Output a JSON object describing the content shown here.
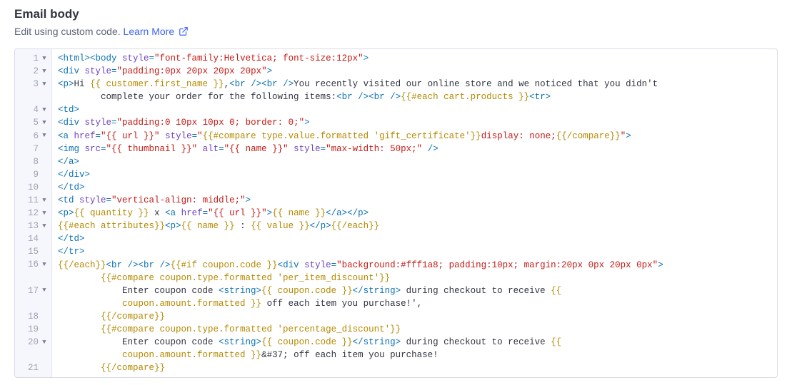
{
  "header": {
    "title": "Email body",
    "subtitle": "Edit using custom code.",
    "learn_more_label": "Learn More"
  },
  "editor": {
    "lines": [
      {
        "n": 1,
        "fold": true,
        "segments": [
          {
            "c": "tag",
            "t": "<html><body"
          },
          {
            "c": "attr",
            "t": " style"
          },
          {
            "c": "tag",
            "t": "="
          },
          {
            "c": "str",
            "t": "\"font-family:Helvetica; font-size:12px\""
          },
          {
            "c": "tag",
            "t": ">"
          }
        ]
      },
      {
        "n": 2,
        "fold": true,
        "segments": [
          {
            "c": "tag",
            "t": "<div"
          },
          {
            "c": "attr",
            "t": " style"
          },
          {
            "c": "tag",
            "t": "="
          },
          {
            "c": "str",
            "t": "\"padding:0px 20px 20px 20px\""
          },
          {
            "c": "tag",
            "t": ">"
          }
        ]
      },
      {
        "n": 3,
        "fold": true,
        "segments": [
          {
            "c": "tag",
            "t": "<p>"
          },
          {
            "c": "txt",
            "t": "Hi "
          },
          {
            "c": "hb",
            "t": "{{ customer.first_name }}"
          },
          {
            "c": "txt",
            "t": ","
          },
          {
            "c": "tag",
            "t": "<br /><br />"
          },
          {
            "c": "txt",
            "t": "You recently visited our online store and we noticed that you didn't "
          }
        ]
      },
      {
        "n": null,
        "fold": false,
        "segments": [
          {
            "c": "txt",
            "t": "        complete your order for the following items:"
          },
          {
            "c": "tag",
            "t": "<br /><br />"
          },
          {
            "c": "hb",
            "t": "{{#each cart.products }}"
          },
          {
            "c": "tag",
            "t": "<tr>"
          }
        ]
      },
      {
        "n": 4,
        "fold": true,
        "segments": [
          {
            "c": "tag",
            "t": "<td>"
          }
        ]
      },
      {
        "n": 5,
        "fold": true,
        "segments": [
          {
            "c": "tag",
            "t": "<div"
          },
          {
            "c": "attr",
            "t": " style"
          },
          {
            "c": "tag",
            "t": "="
          },
          {
            "c": "str",
            "t": "\"padding:0 10px 10px 0; border: 0;\""
          },
          {
            "c": "tag",
            "t": ">"
          }
        ]
      },
      {
        "n": 6,
        "fold": true,
        "segments": [
          {
            "c": "tag",
            "t": "<a"
          },
          {
            "c": "attr",
            "t": " href"
          },
          {
            "c": "tag",
            "t": "="
          },
          {
            "c": "str",
            "t": "\"{{ url }}\""
          },
          {
            "c": "attr",
            "t": " style"
          },
          {
            "c": "tag",
            "t": "="
          },
          {
            "c": "str",
            "t": "\""
          },
          {
            "c": "hb",
            "t": "{{#compare type.value.formatted 'gift_certificate'}}"
          },
          {
            "c": "str",
            "t": "display: none;"
          },
          {
            "c": "hb",
            "t": "{{/compare}}"
          },
          {
            "c": "str",
            "t": "\""
          },
          {
            "c": "tag",
            "t": ">"
          }
        ]
      },
      {
        "n": 7,
        "fold": false,
        "segments": [
          {
            "c": "tag",
            "t": "<img"
          },
          {
            "c": "attr",
            "t": " src"
          },
          {
            "c": "tag",
            "t": "="
          },
          {
            "c": "str",
            "t": "\"{{ thumbnail }}\""
          },
          {
            "c": "attr",
            "t": " alt"
          },
          {
            "c": "tag",
            "t": "="
          },
          {
            "c": "str",
            "t": "\"{{ name }}\""
          },
          {
            "c": "attr",
            "t": " style"
          },
          {
            "c": "tag",
            "t": "="
          },
          {
            "c": "str",
            "t": "\"max-width: 50px;\""
          },
          {
            "c": "tag",
            "t": " />"
          }
        ]
      },
      {
        "n": 8,
        "fold": false,
        "segments": [
          {
            "c": "tag",
            "t": "</a>"
          }
        ]
      },
      {
        "n": 9,
        "fold": false,
        "segments": [
          {
            "c": "tag",
            "t": "</div>"
          }
        ]
      },
      {
        "n": 10,
        "fold": false,
        "segments": [
          {
            "c": "tag",
            "t": "</td>"
          }
        ]
      },
      {
        "n": 11,
        "fold": true,
        "segments": [
          {
            "c": "tag",
            "t": "<td"
          },
          {
            "c": "attr",
            "t": " style"
          },
          {
            "c": "tag",
            "t": "="
          },
          {
            "c": "str",
            "t": "\"vertical-align: middle;\""
          },
          {
            "c": "tag",
            "t": ">"
          }
        ]
      },
      {
        "n": 12,
        "fold": true,
        "segments": [
          {
            "c": "tag",
            "t": "<p>"
          },
          {
            "c": "hb",
            "t": "{{ quantity }}"
          },
          {
            "c": "txt",
            "t": " x "
          },
          {
            "c": "tag",
            "t": "<a"
          },
          {
            "c": "attr",
            "t": " href"
          },
          {
            "c": "tag",
            "t": "="
          },
          {
            "c": "str",
            "t": "\"{{ url }}\""
          },
          {
            "c": "tag",
            "t": ">"
          },
          {
            "c": "hb",
            "t": "{{ name }}"
          },
          {
            "c": "tag",
            "t": "</a></p>"
          }
        ]
      },
      {
        "n": 13,
        "fold": true,
        "segments": [
          {
            "c": "hb",
            "t": "{{#each attributes}}"
          },
          {
            "c": "tag",
            "t": "<p>"
          },
          {
            "c": "hb",
            "t": "{{ name }}"
          },
          {
            "c": "txt",
            "t": " : "
          },
          {
            "c": "hb",
            "t": "{{ value }}"
          },
          {
            "c": "tag",
            "t": "</p>"
          },
          {
            "c": "hb",
            "t": "{{/each}}"
          }
        ]
      },
      {
        "n": 14,
        "fold": false,
        "segments": [
          {
            "c": "tag",
            "t": "</td>"
          }
        ]
      },
      {
        "n": 15,
        "fold": false,
        "segments": [
          {
            "c": "tag",
            "t": "</tr>"
          }
        ]
      },
      {
        "n": 16,
        "fold": true,
        "segments": [
          {
            "c": "hb",
            "t": "{{/each}}"
          },
          {
            "c": "tag",
            "t": "<br /><br />"
          },
          {
            "c": "hb",
            "t": "{{#if coupon.code }}"
          },
          {
            "c": "tag",
            "t": "<div"
          },
          {
            "c": "attr",
            "t": " style"
          },
          {
            "c": "tag",
            "t": "="
          },
          {
            "c": "str",
            "t": "\"background:#fff1a8; padding:10px; margin:20px 0px 20px 0px\""
          },
          {
            "c": "tag",
            "t": ">"
          }
        ]
      },
      {
        "n": null,
        "fold": false,
        "segments": [
          {
            "c": "txt",
            "t": "        "
          },
          {
            "c": "hb",
            "t": "{{#compare coupon.type.formatted 'per_item_discount'}}"
          }
        ]
      },
      {
        "n": 17,
        "fold": true,
        "segments": [
          {
            "c": "txt",
            "t": "            Enter coupon code "
          },
          {
            "c": "tag",
            "t": "<string>"
          },
          {
            "c": "hb",
            "t": "{{ coupon.code }}"
          },
          {
            "c": "tag",
            "t": "</string>"
          },
          {
            "c": "txt",
            "t": " during checkout to receive "
          },
          {
            "c": "hb",
            "t": "{{ "
          }
        ]
      },
      {
        "n": null,
        "fold": false,
        "segments": [
          {
            "c": "txt",
            "t": "            "
          },
          {
            "c": "hb",
            "t": "coupon.amount.formatted }}"
          },
          {
            "c": "txt",
            "t": " off each item you purchase!',"
          }
        ]
      },
      {
        "n": 18,
        "fold": false,
        "segments": [
          {
            "c": "txt",
            "t": "        "
          },
          {
            "c": "hb",
            "t": "{{/compare}}"
          }
        ]
      },
      {
        "n": 19,
        "fold": false,
        "segments": [
          {
            "c": "txt",
            "t": "        "
          },
          {
            "c": "hb",
            "t": "{{#compare coupon.type.formatted 'percentage_discount'}}"
          }
        ]
      },
      {
        "n": 20,
        "fold": true,
        "segments": [
          {
            "c": "txt",
            "t": "            Enter coupon code "
          },
          {
            "c": "tag",
            "t": "<string>"
          },
          {
            "c": "hb",
            "t": "{{ coupon.code }}"
          },
          {
            "c": "tag",
            "t": "</string>"
          },
          {
            "c": "txt",
            "t": " during checkout to receive "
          },
          {
            "c": "hb",
            "t": "{{ "
          }
        ]
      },
      {
        "n": null,
        "fold": false,
        "segments": [
          {
            "c": "txt",
            "t": "            "
          },
          {
            "c": "hb",
            "t": "coupon.amount.formatted }}"
          },
          {
            "c": "txt",
            "t": "&#37; off each item you purchase!"
          }
        ]
      },
      {
        "n": 21,
        "fold": false,
        "segments": [
          {
            "c": "txt",
            "t": "        "
          },
          {
            "c": "hb",
            "t": "{{/compare}}"
          }
        ]
      }
    ]
  }
}
